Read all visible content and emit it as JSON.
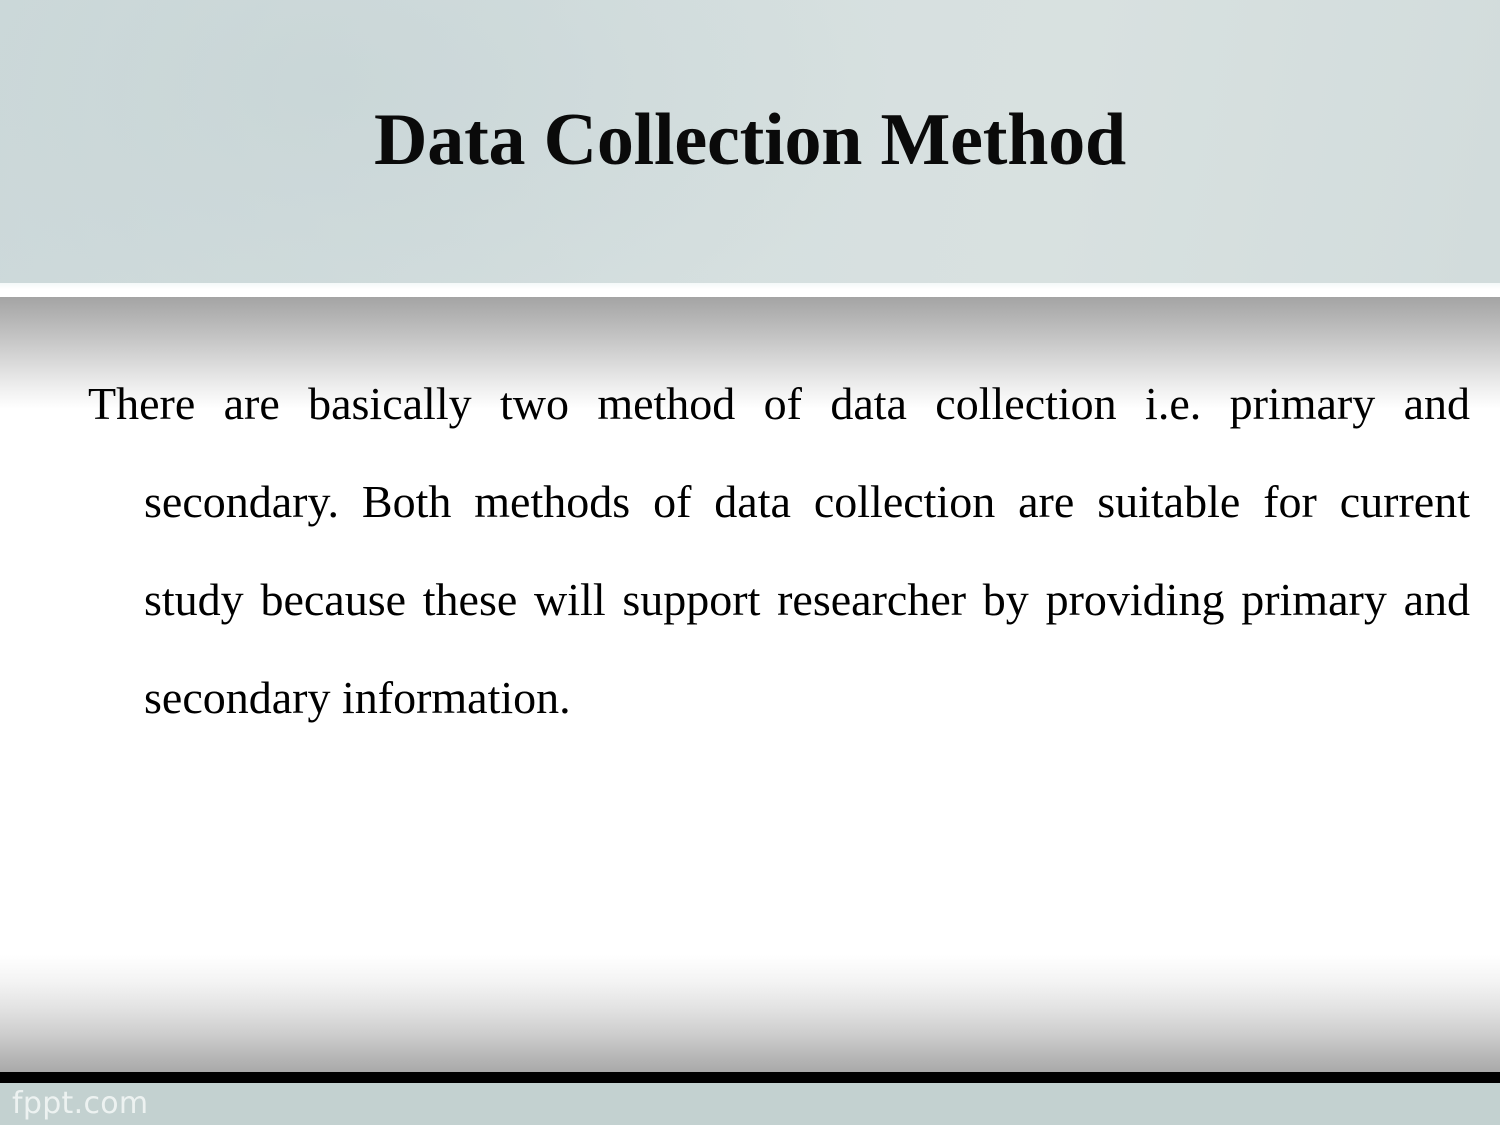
{
  "slide": {
    "title": "Data Collection Method",
    "body_paragraph": "There are basically two method of data collection i.e. primary and secondary. Both methods of data collection are suitable for current study because these will support researcher by providing primary and secondary information.",
    "body_lines": [
      "There are basically two method of data collection i.e.",
      "primary and secondary. Both methods of data collection",
      "are suitable for current study because these will support",
      "researcher by providing primary and secondary",
      "information."
    ],
    "footer_watermark": "fppt.com"
  },
  "colors": {
    "header_band": "#d5dfdf",
    "header_band_shade": "#cdd9da",
    "title_text": "#0a0a0a",
    "body_text": "#000000",
    "divider_shadow": "#a4a4a4",
    "bottom_bar": "#000000",
    "footer_band": "#c3d1d0",
    "footer_watermark_text": "#f1f5f4",
    "slide_background": "#ffffff"
  }
}
